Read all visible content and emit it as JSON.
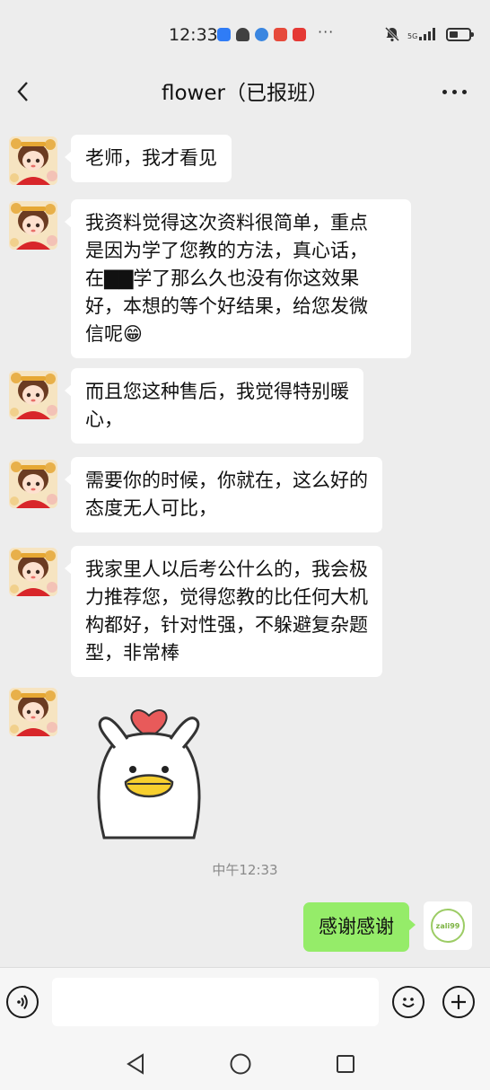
{
  "status_bar": {
    "time": "12:33",
    "more_indicator": "···",
    "network": "5G",
    "app_icons": [
      "#2f7cf6",
      "#404040",
      "#3a86e0",
      "#e64a3b",
      "#e53935"
    ]
  },
  "header": {
    "title": "flower（已报班）",
    "back_icon": "chevron-left-icon",
    "more_icon": "more-dots-icon"
  },
  "messages": [
    {
      "text": "老师，我才看见"
    },
    {
      "text": "我资料觉得这次资料很简单，重点是因为学了您教的方法，真心话，在▇▇学了那么久也没有你这效果好，本想的等个好结果，给您发微信呢😁",
      "lines": [
        "我资料觉得这次资料很简单，重点",
        "是因为学了您教的方法，真心话，",
        "在▇▇学了那么久也没有你这效果",
        "好，本想的等个好结果，给您发微",
        "信呢😁"
      ]
    },
    {
      "lines": [
        "而且您这种售后，我觉得特别暖",
        "心，"
      ]
    },
    {
      "lines": [
        "需要你的时候，你就在，这么好的",
        "态度无人可比，"
      ]
    },
    {
      "lines": [
        "我家里人以后考公什么的，我会极",
        "力推荐您，觉得您教的比任何大机",
        "构都好，针对性强，不躲避复杂题",
        "型，非常棒"
      ]
    }
  ],
  "sticker": {
    "icon": "duck-heart-sticker"
  },
  "time_divider": "中午12:33",
  "outgoing": {
    "text": "感谢感谢"
  },
  "self_avatar": {
    "logo_text": "zali99"
  },
  "input_bar": {
    "voice_icon": "voice-icon",
    "emoji_icon": "emoji-icon",
    "plus_icon": "plus-icon",
    "value": ""
  },
  "colors": {
    "background": "#ededed",
    "incoming_bubble": "#ffffff",
    "outgoing_bubble": "#95ec69"
  }
}
